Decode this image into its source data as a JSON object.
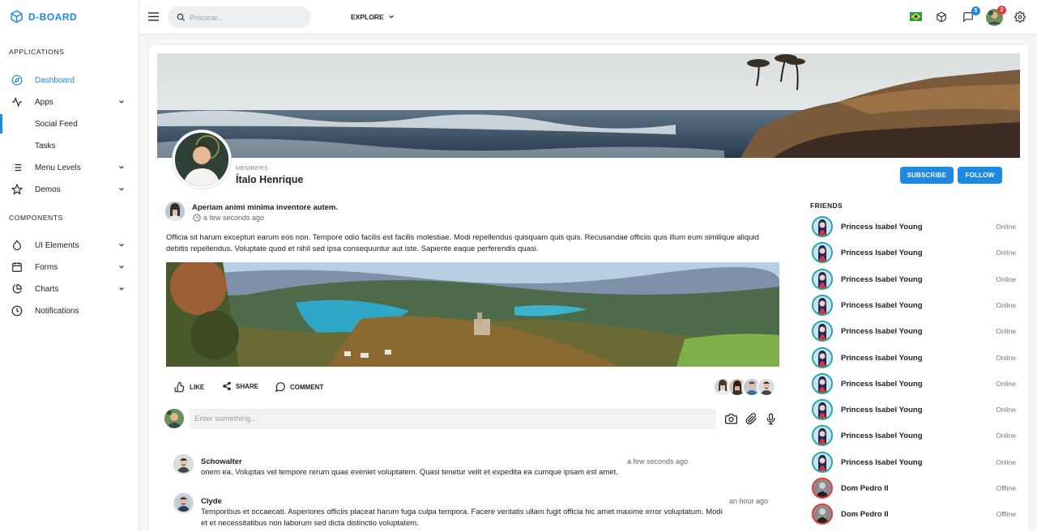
{
  "brand": {
    "name": "D-BOARD"
  },
  "sidebar": {
    "sections": [
      "APPLICATIONS",
      "COMPONENTS"
    ],
    "items": [
      {
        "label": "Dashboard",
        "icon": "compass-icon"
      },
      {
        "label": "Apps",
        "icon": "activity-icon"
      },
      {
        "label": "Social Feed",
        "icon": ""
      },
      {
        "label": "Tasks",
        "icon": ""
      },
      {
        "label": "Menu Levels",
        "icon": "list-icon"
      },
      {
        "label": "Demos",
        "icon": "star-icon"
      },
      {
        "label": "UI Elements",
        "icon": "droplet-icon"
      },
      {
        "label": "Forms",
        "icon": "calendar-icon"
      },
      {
        "label": "Charts",
        "icon": "pie-chart-icon"
      },
      {
        "label": "Notifications",
        "icon": "clock-icon"
      }
    ]
  },
  "header": {
    "search_placeholder": "Procurar...",
    "explore_label": "EXPLORE",
    "messages_badge": "5",
    "profile_badge": "2",
    "accent": "#1e88e5"
  },
  "profile": {
    "members_label": "MEMBERS",
    "name": "Ítalo Henrique",
    "subscribe_label": "SUBSCRIBE",
    "follow_label": "FOLLOW"
  },
  "post": {
    "title": "Aperiam animi minima inventore autem.",
    "time": "a few seconds ago",
    "body": "Officia sit harum excepturi earum eos non. Tempore odio facilis est facilis molestiae. Modi repellendus quisquam quis quis. Recusandae officiis quis illum eum similique aliquid debitis repellendus. Voluptate quod et nihil sed ipsa consequuntur aut iste. Sapiente eaque perferendis quasi.",
    "like_label": "LIKE",
    "share_label": "SHARE",
    "comment_label": "COMMENT",
    "comment_placeholder": "Enter something..."
  },
  "comments": [
    {
      "author": "Schowalter",
      "time": "a few seconds ago",
      "text": "onem ea. Voluptas vel tempore rerum quae eveniet voluptatem. Quasi tenetur velit et expedita ea cumque ipsam est amet."
    },
    {
      "author": "Clyde",
      "time": "an hour ago",
      "text": "Temporibus et occaecati. Asperiores officiis placeat harum fuga culpa tempora. Facere veritatis ullam fugit officia hic amet maxime error voluptatum. Modi et et necessitatibus non laborum sed dicta distinctio voluptatem."
    }
  ],
  "friends": {
    "title": "FRIENDS",
    "list": [
      {
        "name": "Princess Isabel Young",
        "status": "Online"
      },
      {
        "name": "Princess Isabel Young",
        "status": "Online"
      },
      {
        "name": "Princess Isabel Young",
        "status": "Online"
      },
      {
        "name": "Princess Isabel Young",
        "status": "Online"
      },
      {
        "name": "Princess Isabel Young",
        "status": "Online"
      },
      {
        "name": "Princess Isabel Young",
        "status": "Online"
      },
      {
        "name": "Princess Isabel Young",
        "status": "Online"
      },
      {
        "name": "Princess Isabel Young",
        "status": "Online"
      },
      {
        "name": "Princess Isabel Young",
        "status": "Online"
      },
      {
        "name": "Princess Isabel Young",
        "status": "Online"
      },
      {
        "name": "Dom Pedro II",
        "status": "Offline"
      },
      {
        "name": "Dom Pedro II",
        "status": "Offline"
      }
    ]
  }
}
